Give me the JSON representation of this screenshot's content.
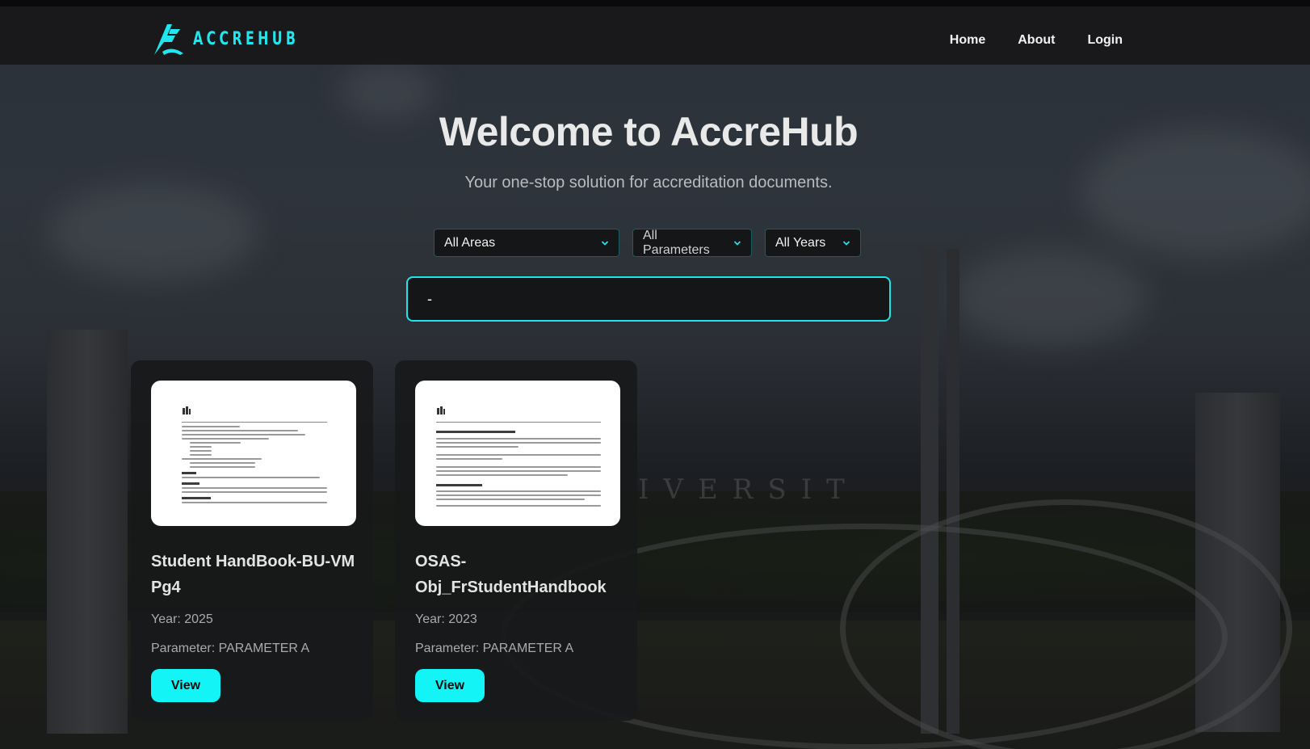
{
  "brand": {
    "name": "ACCREHUB",
    "accent": "#1ee7ef"
  },
  "nav": {
    "home": "Home",
    "about": "About",
    "login": "Login"
  },
  "hero": {
    "title": "Welcome to AccreHub",
    "subtitle": "Your one-stop solution for accreditation documents."
  },
  "filters": {
    "areas": "All Areas",
    "parameters": "All Parameters",
    "years": "All Years"
  },
  "search": {
    "value": "-"
  },
  "background": {
    "sign_text": "IVERSIT"
  },
  "cards": [
    {
      "title": "Student HandBook-BU-VM Pg4",
      "year": "Year: 2025",
      "parameter": "Parameter: PARAMETER A",
      "button": "View",
      "thumb_lines": [
        "• UN-Bagatel among SUCs in Graduates",
        "• Base Agency for Bicol Consortium for Health Research and Development (BCHRD)",
        "• Base Agency for Bicol Consortium for Agriculture, Aquatic, and Natural Resources Research and Development",
        "• No. of PAQCCUP Accredited Programs",
        "Level IV (Qualified) – 2",
        "Level III – 37",
        "Level II – 27",
        "Level I – 27",
        "• Top Performing School in PRC Licensure Examinations",
        "Vision",
        "A Leading Global University Producing Leaders and Change Agents for Social Transformation and Development",
        "Mission",
        "The Bicol University shall give professional and technical training, and provide advanced and specialized instruction",
        "Quality Policy"
      ]
    },
    {
      "title": "OSAS-Obj_FrStudentHandbook",
      "year": "Year: 2023",
      "parameter": "Parameter: PARAMETER A",
      "button": "View",
      "thumb_lines": [
        "V. STUDENT AFFAIRS AND SERVICES",
        "Objectives of the OSAS"
      ]
    }
  ]
}
